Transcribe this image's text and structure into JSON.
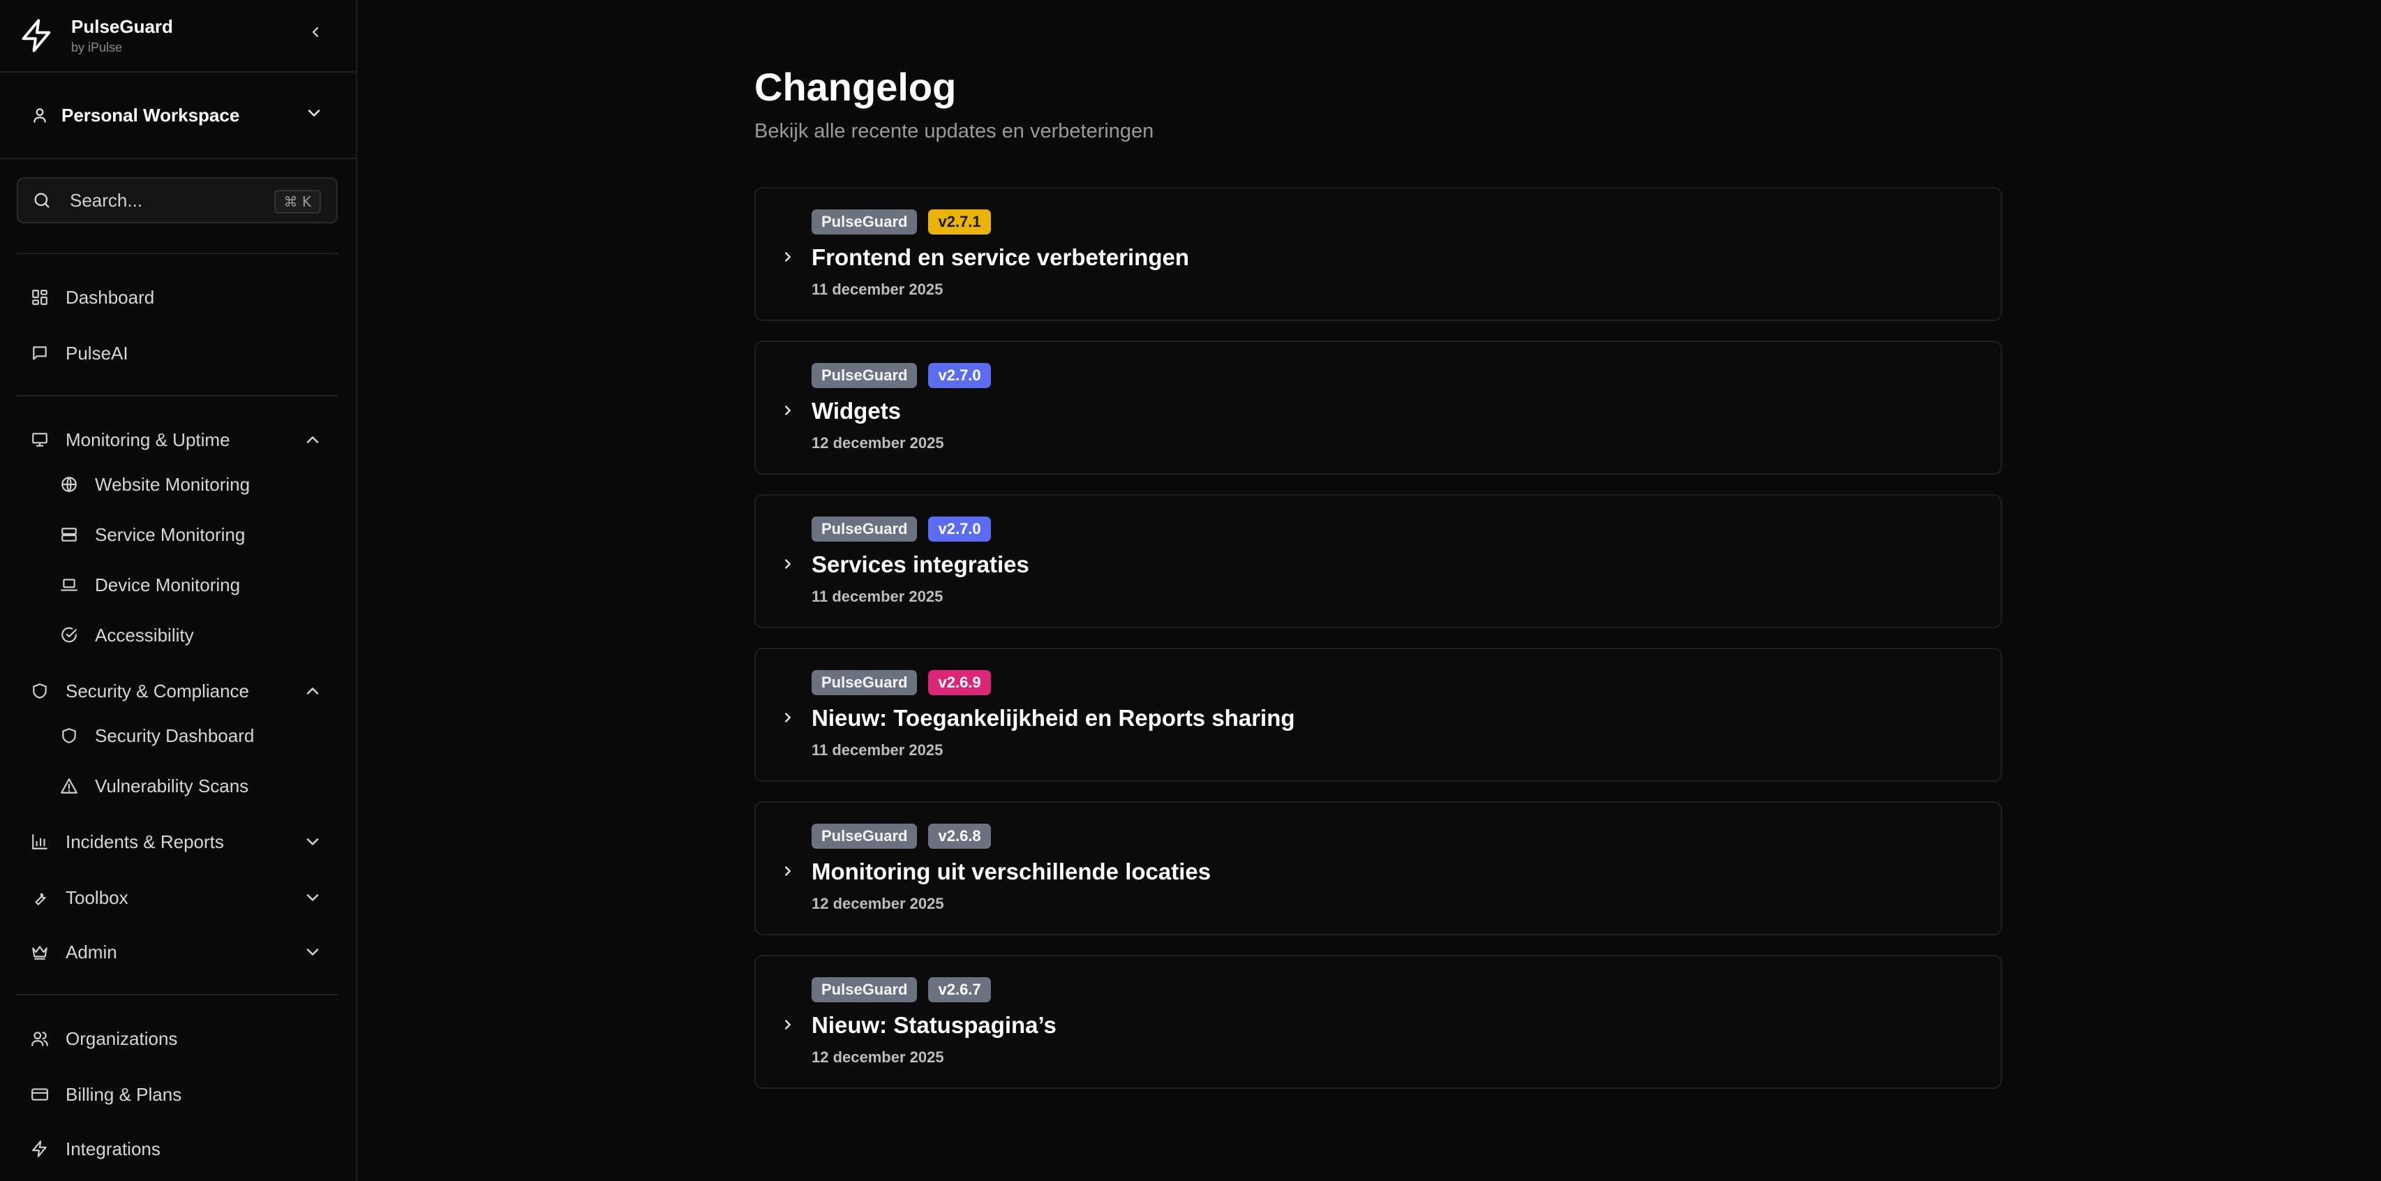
{
  "brand": {
    "name": "PulseGuard",
    "by": "by iPulse"
  },
  "workspace": {
    "label": "Personal Workspace"
  },
  "search": {
    "placeholder": "Search...",
    "shortcut": "⌘ K"
  },
  "nav": {
    "dashboard": "Dashboard",
    "pulseai": "PulseAI",
    "monitoring": {
      "label": "Monitoring & Uptime",
      "items": [
        "Website Monitoring",
        "Service Monitoring",
        "Device Monitoring",
        "Accessibility"
      ]
    },
    "security": {
      "label": "Security & Compliance",
      "items": [
        "Security Dashboard",
        "Vulnerability Scans"
      ]
    },
    "incidents": "Incidents & Reports",
    "toolbox": "Toolbox",
    "admin": "Admin",
    "organizations": "Organizations",
    "billing": "Billing & Plans",
    "integrations": "Integrations"
  },
  "page": {
    "title": "Changelog",
    "subtitle": "Bekijk alle recente updates en verbeteringen"
  },
  "entries": [
    {
      "product": "PulseGuard",
      "version": "v2.7.1",
      "version_color": "#eab308",
      "version_text": "#1a1a1a",
      "title": "Frontend en service verbeteringen",
      "date": "11 december 2025"
    },
    {
      "product": "PulseGuard",
      "version": "v2.7.0",
      "version_color": "#5b6cf0",
      "version_text": "#ffffff",
      "title": "Widgets",
      "date": "12 december 2025"
    },
    {
      "product": "PulseGuard",
      "version": "v2.7.0",
      "version_color": "#5b6cf0",
      "version_text": "#ffffff",
      "title": "Services integraties",
      "date": "11 december 2025"
    },
    {
      "product": "PulseGuard",
      "version": "v2.6.9",
      "version_color": "#db2777",
      "version_text": "#ffffff",
      "title": "Nieuw: Toegankelijkheid en Reports sharing",
      "date": "11 december 2025"
    },
    {
      "product": "PulseGuard",
      "version": "v2.6.8",
      "version_color": "#6b7280",
      "version_text": "#ffffff",
      "title": "Monitoring uit verschillende locaties",
      "date": "12 december 2025"
    },
    {
      "product": "PulseGuard",
      "version": "v2.6.7",
      "version_color": "#6b7280",
      "version_text": "#ffffff",
      "title": "Nieuw: Statuspagina’s",
      "date": "12 december 2025"
    }
  ]
}
